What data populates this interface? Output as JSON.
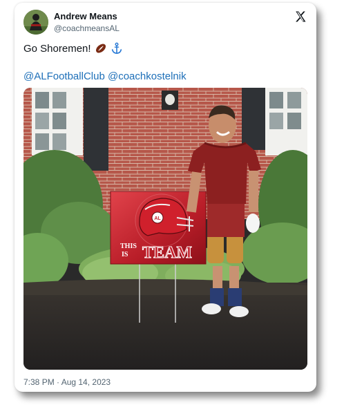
{
  "author": {
    "name": "Andrew Means",
    "handle": "@coachmeansAL"
  },
  "tweet": {
    "text": "Go Shoremen!",
    "emojis": [
      "football-emoji",
      "anchor-emoji"
    ],
    "mentions": [
      "@ALFootballClub",
      "@coachkostelnik"
    ],
    "timestamp": "7:38 PM · Aug 14, 2023"
  },
  "media": {
    "sign_text_line1": "THIS",
    "sign_text_line2": "IS",
    "sign_text_team": "TEAM",
    "helmet_logo": "AL"
  },
  "colors": {
    "link": "#1d6fb8",
    "text": "#0f1419",
    "muted": "#536471",
    "sign_red": "#c41e2a"
  }
}
